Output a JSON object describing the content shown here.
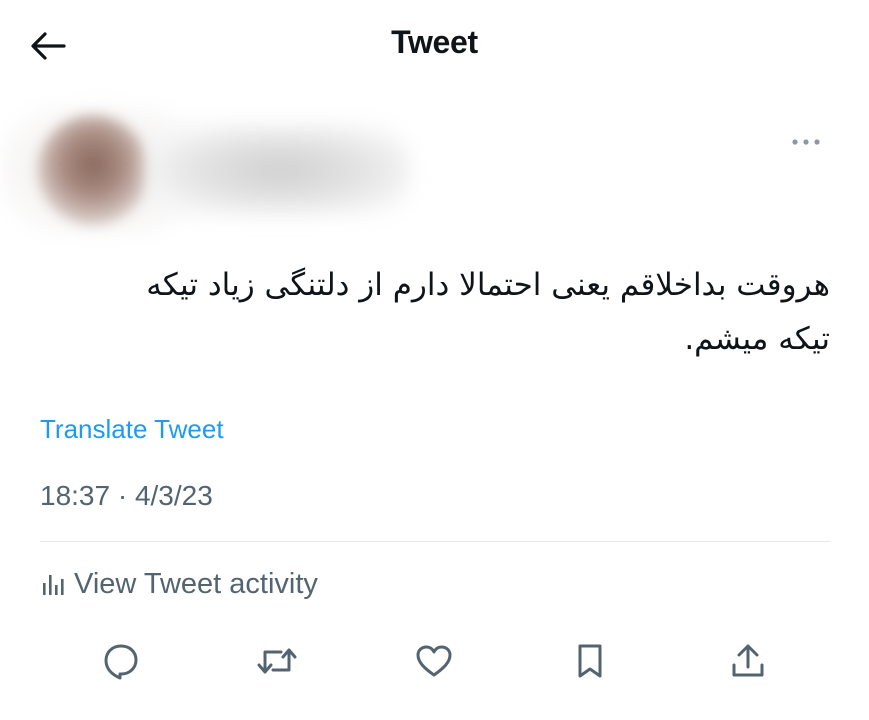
{
  "header": {
    "title": "Tweet",
    "back_icon": "arrow-left-icon"
  },
  "tweet": {
    "text_line1": "هروقت بداخلاقم یعنی احتمالا دارم از دلتنگی زیاد تیکه",
    "text_line2": "تیکه میشم.",
    "translate_label": "Translate Tweet",
    "timestamp": "18:37 · 4/3/23",
    "activity_label": "View Tweet activity"
  },
  "actions": [
    {
      "icon": "reply-icon"
    },
    {
      "icon": "retweet-icon"
    },
    {
      "icon": "like-icon"
    },
    {
      "icon": "bookmark-icon"
    },
    {
      "icon": "share-icon"
    }
  ],
  "colors": {
    "accent": "#1d9bf0",
    "text": "#0f1419",
    "secondary": "#536471",
    "divider": "#e6e9eb"
  }
}
